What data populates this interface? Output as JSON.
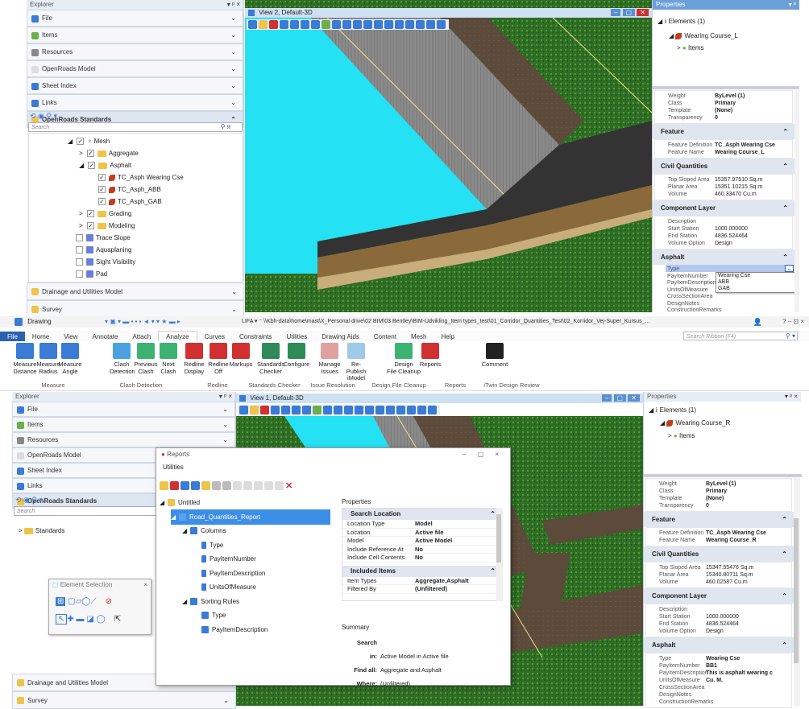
{
  "top": {
    "explorer_title": "Explorer",
    "explorer_ctl": "▾ ᵖ ×",
    "sections": [
      {
        "label": "File",
        "color": "#3a7bd5"
      },
      {
        "label": "Items",
        "color": "#6ab04c"
      },
      {
        "label": "Resources",
        "color": "#888"
      },
      {
        "label": "OpenRoads Model",
        "color": "#ddd"
      },
      {
        "label": "Sheet Index",
        "color": "#3a7bd5"
      },
      {
        "label": "Links",
        "color": "#3a7bd5"
      },
      {
        "label": "OpenRoads Standards",
        "color": "#f0c44a"
      }
    ],
    "search_placeholder": "Search",
    "tree": [
      {
        "label": "Mesh",
        "indent": 0,
        "toggle": "◢",
        "check": "✓",
        "icon": "mesh"
      },
      {
        "label": "Aggregate",
        "indent": 1,
        "toggle": ">",
        "check": "✓",
        "icon": "folder"
      },
      {
        "label": "Asphalt",
        "indent": 1,
        "toggle": "◢",
        "check": "✓",
        "icon": "folder"
      },
      {
        "label": "TC_Asph Wearing Cse",
        "indent": 2,
        "toggle": "",
        "check": "✓",
        "icon": "feature"
      },
      {
        "label": "TC_Asph_ABB",
        "indent": 2,
        "toggle": "",
        "check": "✓",
        "icon": "feature"
      },
      {
        "label": "TC_Asph_GAB",
        "indent": 2,
        "toggle": "",
        "check": "✓",
        "icon": "feature"
      },
      {
        "label": "Grading",
        "indent": 1,
        "toggle": ">",
        "check": "✓",
        "icon": "folder"
      },
      {
        "label": "Modeling",
        "indent": 1,
        "toggle": ">",
        "check": "✓",
        "icon": "folder"
      },
      {
        "label": "Trace Slope",
        "indent": 0,
        "toggle": "",
        "check": "",
        "icon": "blue"
      },
      {
        "label": "Aquaplaning",
        "indent": 0,
        "toggle": "",
        "check": "",
        "icon": "blue"
      },
      {
        "label": "Sight Visibility",
        "indent": 0,
        "toggle": "",
        "check": "",
        "icon": "blue"
      },
      {
        "label": "Pad",
        "indent": 0,
        "toggle": "",
        "check": "",
        "icon": "blue"
      }
    ],
    "bottom_sections": [
      "Drainage and Utilities Model",
      "Survey"
    ],
    "view_title": "View 2, Default-3D",
    "props_title": "Properties",
    "props_ctl": "▾ ᵖ",
    "elements": "Elements (1)",
    "element_name": "Wearing Course_L",
    "items": "Items",
    "general": [
      [
        "Weight",
        "ByLevel (1)"
      ],
      [
        "Class",
        "Primary"
      ],
      [
        "Template",
        "(None)"
      ],
      [
        "Transparency",
        "0"
      ]
    ],
    "feature_title": "Feature",
    "feature": [
      [
        "Feature Definition",
        "TC_Asph Wearing Cse"
      ],
      [
        "Feature Name",
        "Wearing Course_L"
      ]
    ],
    "civil_title": "Civil Quantities",
    "civil": [
      [
        "Top Sloped Area",
        "15357.97510 Sq.m"
      ],
      [
        "Planar Area",
        "15351.10215 Sq.m"
      ],
      [
        "Volume",
        "460.33470 Cu.m"
      ]
    ],
    "comp_title": "Component Layer",
    "comp": [
      [
        "Description",
        ""
      ],
      [
        "Start Station",
        "1000.000000"
      ],
      [
        "End Station",
        "4836.524464"
      ],
      [
        "Volume Option",
        "Design"
      ]
    ],
    "asphalt_title": "Asphalt",
    "asphalt_labels": [
      "Type",
      "PayItemNumber",
      "PayItemDescription",
      "UnitsOfMeasure",
      "CrossSectionArea",
      "DesignNotes",
      "ConstructionRemarks"
    ],
    "dropdown_options": [
      "Wearing Cse",
      "ABB",
      "GAB"
    ]
  },
  "app": {
    "title": "Drawing",
    "path": "LIFA ▾  ⁼ \\\\Kbh-data\\home\\mast\\X_Personal drive\\02 BIM\\03 Bentley\\BIM-Udvikling_Item types_test\\01_Corridor_Quantities_Test\\02_Korridor_Vej-Super_Kursus_...",
    "win_ctl": "? – ⊡ ×",
    "tabs": [
      "File",
      "Home",
      "View",
      "Annotate",
      "Attach",
      "Analyze",
      "Curves",
      "Constraints",
      "Utilities",
      "Drawing Aids",
      "Content",
      "Mesh",
      "Help"
    ],
    "active_tab": "Analyze",
    "search_ribbon": "Search Ribbon (F4)",
    "buttons": [
      {
        "label": "Measure\nDistance",
        "color": "#3a7bd5"
      },
      {
        "label": "Measure\nRadius",
        "color": "#3a7bd5"
      },
      {
        "label": "Measure\nAngle",
        "color": "#3a7bd5"
      },
      {
        "label": "Clash\nDetection",
        "color": "#4aa3df"
      },
      {
        "label": "Previous\nClash",
        "color": "#3cb371"
      },
      {
        "label": "Next\nClash",
        "color": "#3cb371"
      },
      {
        "label": "Redline\nDisplay",
        "color": "#d03030"
      },
      {
        "label": "Redline\nOff",
        "color": "#d03030"
      },
      {
        "label": "Markups",
        "color": "#d03030"
      },
      {
        "label": "Standards\nChecker",
        "color": "#2e8b57"
      },
      {
        "label": "Configure",
        "color": "#2e8b57"
      },
      {
        "label": "Manage\nIssues",
        "color": "#e0a0a0"
      },
      {
        "label": "Re-Publish\niModel",
        "color": "#9ec9e8"
      },
      {
        "label": "Design\nFile Cleanup",
        "color": "#3cb371"
      },
      {
        "label": "Reports",
        "color": "#d03030"
      },
      {
        "label": "Comment",
        "color": "#222"
      }
    ],
    "groups": [
      "Measure",
      "Clash Detection",
      "Redline",
      "Standards Checker",
      "Issue Resolution",
      "Design File Cleanup",
      "Reports",
      "iTwin Design Review"
    ]
  },
  "bottom": {
    "explorer_title": "Explorer",
    "explorer_ctl": "▾ ᵖ ×",
    "sections": [
      {
        "label": "File",
        "color": "#3a7bd5"
      },
      {
        "label": "Items",
        "color": "#6ab04c"
      },
      {
        "label": "Resources",
        "color": "#888"
      },
      {
        "label": "OpenRoads Model",
        "color": "#ddd"
      },
      {
        "label": "Sheet Index",
        "color": "#3a7bd5"
      },
      {
        "label": "Links",
        "color": "#3a7bd5"
      },
      {
        "label": "OpenRoads Standards",
        "color": "#f0c44a"
      }
    ],
    "search_placeholder": "Search",
    "standards": "Standards",
    "bottom_sections": [
      "Drainage and Utilities Model",
      "Survey"
    ],
    "view_title": "View 1, Default-3D",
    "element_selection": "Element Selection",
    "props_title": "Properties",
    "props_ctl": "▾ ᵖ ×",
    "elements": "Elements (1)",
    "element_name": "Wearing Course_R",
    "items": "Items",
    "general": [
      [
        "Weight",
        "ByLevel (1)"
      ],
      [
        "Class",
        "Primary"
      ],
      [
        "Template",
        "(None)"
      ],
      [
        "Transparency",
        "0"
      ]
    ],
    "feature_title": "Feature",
    "feature": [
      [
        "Feature Definition",
        "TC_Asph Wearing Cse"
      ],
      [
        "Feature Name",
        "Wearing Course_R"
      ]
    ],
    "civil_title": "Civil Quantities",
    "civil": [
      [
        "Top Sloped Area",
        "15347.55476 Sq.m"
      ],
      [
        "Planar Area",
        "15340.80711 Sq.m"
      ],
      [
        "Volume",
        "460.02587 Cu.m"
      ]
    ],
    "comp_title": "Component Layer",
    "comp": [
      [
        "Description",
        ""
      ],
      [
        "Start Station",
        "1000.000000"
      ],
      [
        "End Station",
        "4836.524464"
      ],
      [
        "Volume Option",
        "Design"
      ]
    ],
    "asphalt_title": "Asphalt",
    "asphalt": [
      [
        "Type",
        "Wearing Cse"
      ],
      [
        "PayItemNumber",
        "BB1"
      ],
      [
        "PayItemDescription",
        "This is asphalt wearing c"
      ],
      [
        "UnitsOfMeasure",
        "Cu. M."
      ],
      [
        "CrossSectionArea",
        ""
      ],
      [
        "DesignNotes",
        ""
      ],
      [
        "ConstructionRemarks",
        ""
      ]
    ]
  },
  "reports": {
    "title": "Reports",
    "menu": "Utilities",
    "ctl": "– ▢ ×",
    "tree": [
      {
        "label": "Untitled",
        "indent": 0,
        "toggle": "◢",
        "icon": "folder"
      },
      {
        "label": "Road_Quantities_Report",
        "indent": 1,
        "toggle": "◢",
        "icon": "report",
        "selected": true
      },
      {
        "label": "Columns",
        "indent": 2,
        "toggle": "◢",
        "icon": "table"
      },
      {
        "label": "Type",
        "indent": 3,
        "toggle": "",
        "icon": "col"
      },
      {
        "label": "PayItemNumber",
        "indent": 3,
        "toggle": "",
        "icon": "col"
      },
      {
        "label": "PayItemDescription",
        "indent": 3,
        "toggle": "",
        "icon": "col"
      },
      {
        "label": "UnitsOfMeasure",
        "indent": 3,
        "toggle": "",
        "icon": "col"
      },
      {
        "label": "Sorting Rules",
        "indent": 2,
        "toggle": "◢",
        "icon": "table"
      },
      {
        "label": "Type",
        "indent": 3,
        "toggle": "",
        "icon": "table"
      },
      {
        "label": "PayItemDescription",
        "indent": 3,
        "toggle": "",
        "icon": "table"
      }
    ],
    "props_label": "Properties",
    "search_location": "Search Location",
    "location": [
      [
        "Location Type",
        "Model"
      ],
      [
        "Location",
        "Active file"
      ],
      [
        "Model",
        "Active Model"
      ],
      [
        "Include Reference At",
        "No"
      ],
      [
        "Include Cell Contents",
        "No"
      ]
    ],
    "included_items": "Included Items",
    "included": [
      [
        "Item Types",
        "Aggregate,Asphalt"
      ],
      [
        "Filtered By",
        "(Unfiltered)"
      ]
    ],
    "summary_label": "Summary",
    "summary": [
      [
        "Search in:",
        "Active Model  in Active file"
      ],
      [
        "Find all:",
        "Aggregate and Asphalt"
      ],
      [
        "Where:",
        "(Unfiltered)"
      ]
    ]
  }
}
